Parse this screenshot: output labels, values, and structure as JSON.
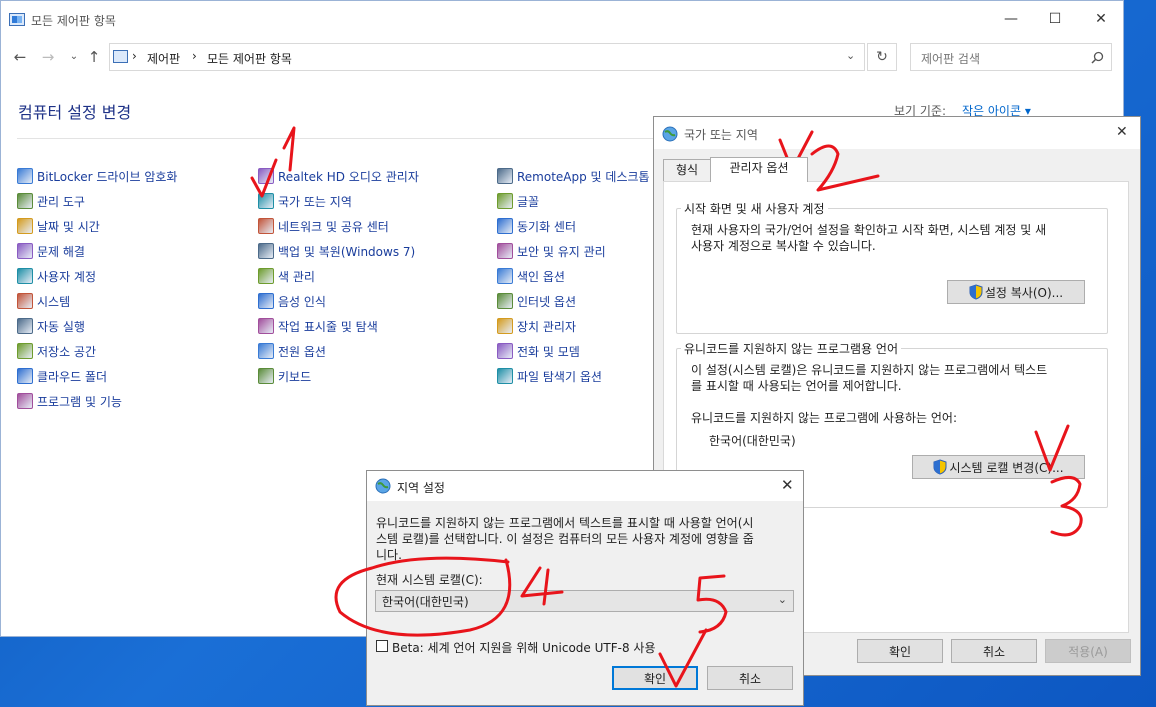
{
  "control_panel": {
    "window_title": "모든 제어판 항목",
    "breadcrumb": [
      "제어판",
      "모든 제어판 항목"
    ],
    "search_placeholder": "제어판 검색",
    "page_title": "컴퓨터 설정 변경",
    "view_by_label": "보기 기준:",
    "view_by_value": "작은 아이콘 ▾",
    "items": [
      [
        "BitLocker 드라이브 암호화",
        "관리 도구",
        "날짜 및 시간",
        "문제 해결",
        "사용자 계정",
        "시스템",
        "자동 실행",
        "저장소 공간",
        "클라우드 폴더",
        "프로그램 및 기능"
      ],
      [
        "Realtek HD 오디오 관리자",
        "국가 또는 지역",
        "네트워크 및 공유 센터",
        "백업 및 복원(Windows 7)",
        "색 관리",
        "음성 인식",
        "작업 표시줄 및 탐색",
        "전원 옵션",
        "키보드"
      ],
      [
        "RemoteApp 및 데스크톱",
        "글꼴",
        "동기화 센터",
        "보안 및 유지 관리",
        "색인 옵션",
        "인터넷 옵션",
        "장치 관리자",
        "전화 및 모뎀",
        "파일 탐색기 옵션"
      ]
    ]
  },
  "region_dialog": {
    "title": "국가 또는 지역",
    "tabs": [
      "형식",
      "관리자 옵션"
    ],
    "welcome_group": {
      "title": "시작 화면 및 새 사용자 계정",
      "desc_line1": "현재 사용자의 국가/언어 설정을 확인하고 시작 화면, 시스템 계정 및 새",
      "desc_line2": "사용자 계정으로 복사할 수 있습니다.",
      "button": "설정 복사(O)..."
    },
    "unicode_group": {
      "title": "유니코드를 지원하지 않는 프로그램용 언어",
      "desc_line1": "이 설정(시스템 로캘)은 유니코드를 지원하지 않는 프로그램에서 텍스트",
      "desc_line2": "를 표시할 때 사용되는 언어를 제어합니다.",
      "current_label": "유니코드를 지원하지 않는 프로그램에 사용하는 언어:",
      "current_value": "한국어(대한민국)",
      "button": "시스템 로캘 변경(C)..."
    },
    "ok": "확인",
    "cancel": "취소",
    "apply": "적용(A)"
  },
  "region_settings": {
    "title": "지역 설정",
    "desc_line1": "유니코드를 지원하지 않는 프로그램에서 텍스트를 표시할 때 사용할 언어(시",
    "desc_line2": "스템 로캘)를 선택합니다. 이 설정은 컴퓨터의 모든 사용자 계정에 영향을 줍",
    "desc_line3": "니다.",
    "locale_label": "현재 시스템 로캘(C):",
    "locale_value": "한국어(대한민국)",
    "beta_label": "Beta: 세계 언어 지원을 위해 Unicode UTF-8 사용",
    "beta_checked": false,
    "ok": "확인",
    "cancel": "취소"
  },
  "annotations": {
    "marks": [
      "1",
      "2",
      "3",
      "4",
      "5"
    ],
    "color": "#e8141b"
  },
  "colors": {
    "link": "#1a3d9c",
    "title_blue": "#1e3287",
    "accent": "#0078d7"
  }
}
